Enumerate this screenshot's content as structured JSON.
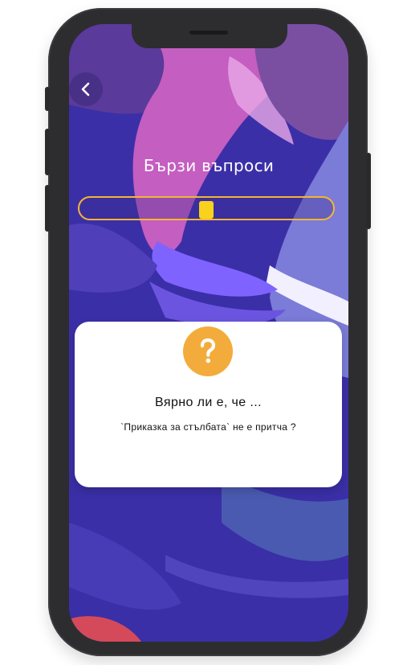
{
  "screen": {
    "title": "Бързи въпроси",
    "back_icon": "chevron-left-icon"
  },
  "progress": {
    "marker_fraction": 0.5,
    "border_color": "#f5b532",
    "marker_color": "#f8d21c"
  },
  "card": {
    "icon": "question-mark-icon",
    "icon_color": "#f3ac3b",
    "icon_glyph": "?",
    "heading": "Вярно ли е, че ...",
    "question": "`Приказка за стълбата` не е притча ?"
  },
  "colors": {
    "background_base": "#3b2fa8",
    "accent_pink": "#c45ec0",
    "accent_purple": "#6a4ea8",
    "accent_blue": "#4a5ab0"
  }
}
